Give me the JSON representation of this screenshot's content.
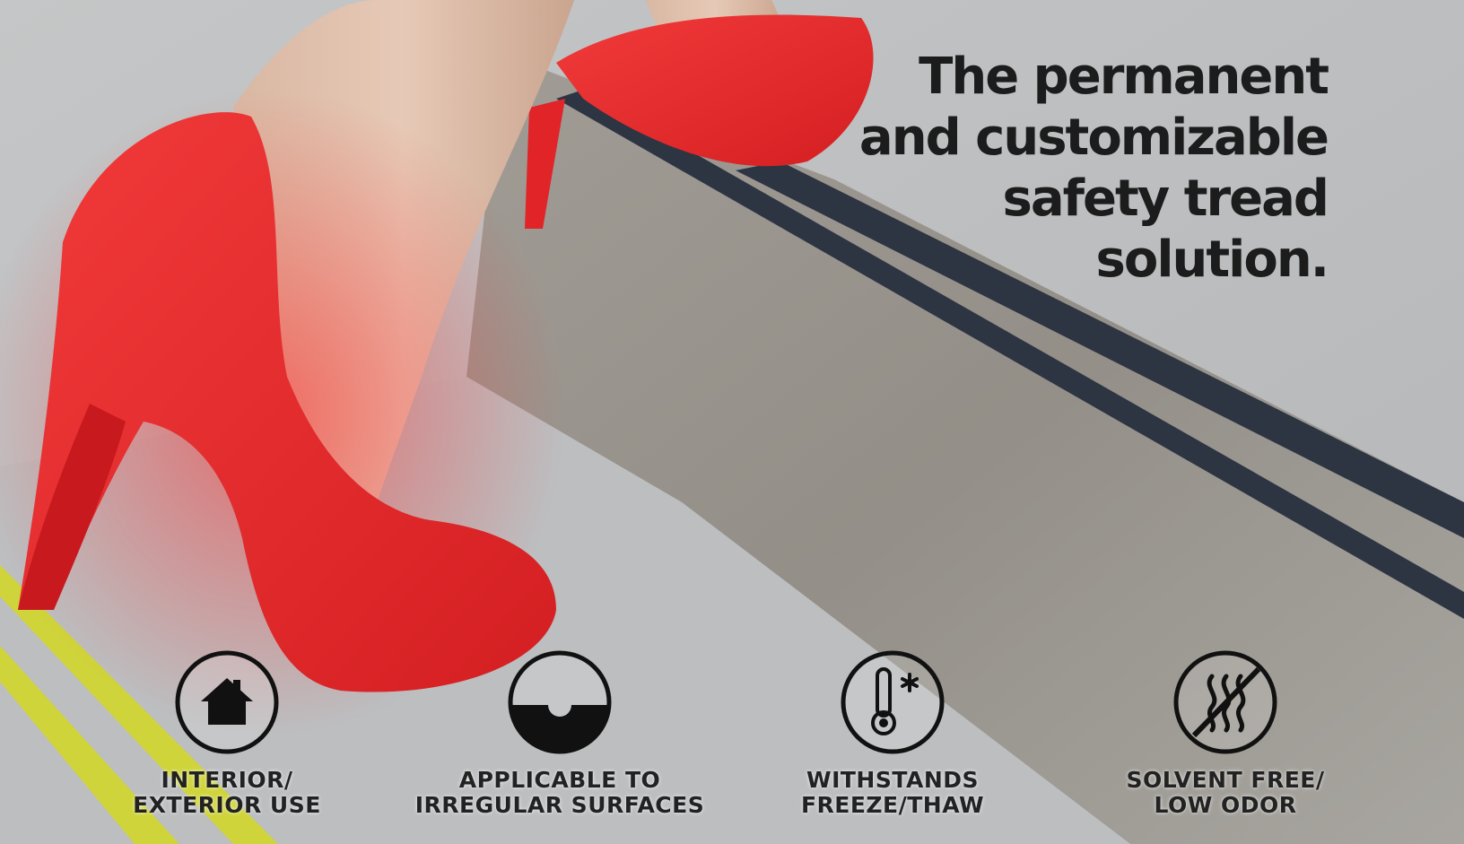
{
  "headline": {
    "lines": [
      "The permanent",
      "and customizable",
      "safety tread",
      "solution."
    ]
  },
  "features": [
    {
      "icon": "house-icon",
      "lines": [
        "INTERIOR/",
        "EXTERIOR USE"
      ]
    },
    {
      "icon": "irregular-surface-icon",
      "lines": [
        "APPLICABLE TO",
        "IRREGULAR SURFACES"
      ]
    },
    {
      "icon": "thermometer-snowflake-icon",
      "lines": [
        "WITHSTANDS",
        "FREEZE/THAW"
      ]
    },
    {
      "icon": "no-odor-icon",
      "lines": [
        "SOLVENT FREE/",
        "LOW ODOR"
      ]
    }
  ],
  "colors": {
    "shoe": "#e8282c",
    "tread_stripe": "#2d3442",
    "yellow_stripe": "#cfd43a",
    "concrete": "#b9bbbc",
    "text": "#1c1c1c"
  }
}
